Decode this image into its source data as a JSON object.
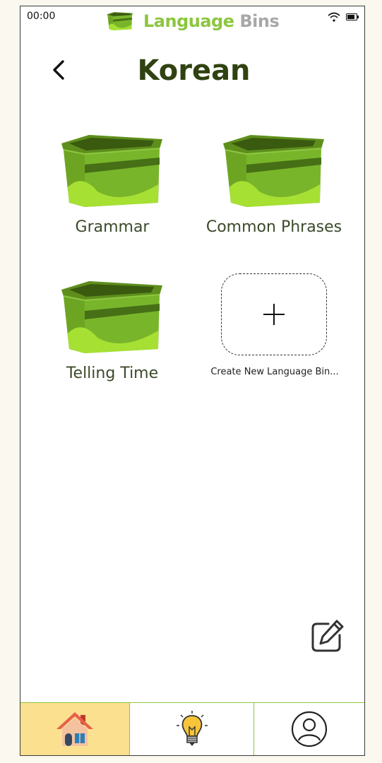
{
  "status_bar": {
    "time": "00:00"
  },
  "app": {
    "brand_word1": "Language",
    "brand_word2": "Bins",
    "accent_color": "#8cc63f",
    "title_color": "#2f4210"
  },
  "header": {
    "title": "Korean"
  },
  "bins": [
    {
      "label": "Grammar",
      "icon": "storage-bin-icon"
    },
    {
      "label": "Common Phrases",
      "icon": "storage-bin-icon"
    },
    {
      "label": "Telling Time",
      "icon": "storage-bin-icon"
    }
  ],
  "create_bin": {
    "label": "Create New Language Bin..."
  },
  "bottom_nav": [
    {
      "name": "home",
      "icon": "house-icon",
      "active": true
    },
    {
      "name": "ideas",
      "icon": "lightbulb-icon",
      "active": false
    },
    {
      "name": "profile",
      "icon": "user-icon",
      "active": false
    }
  ]
}
